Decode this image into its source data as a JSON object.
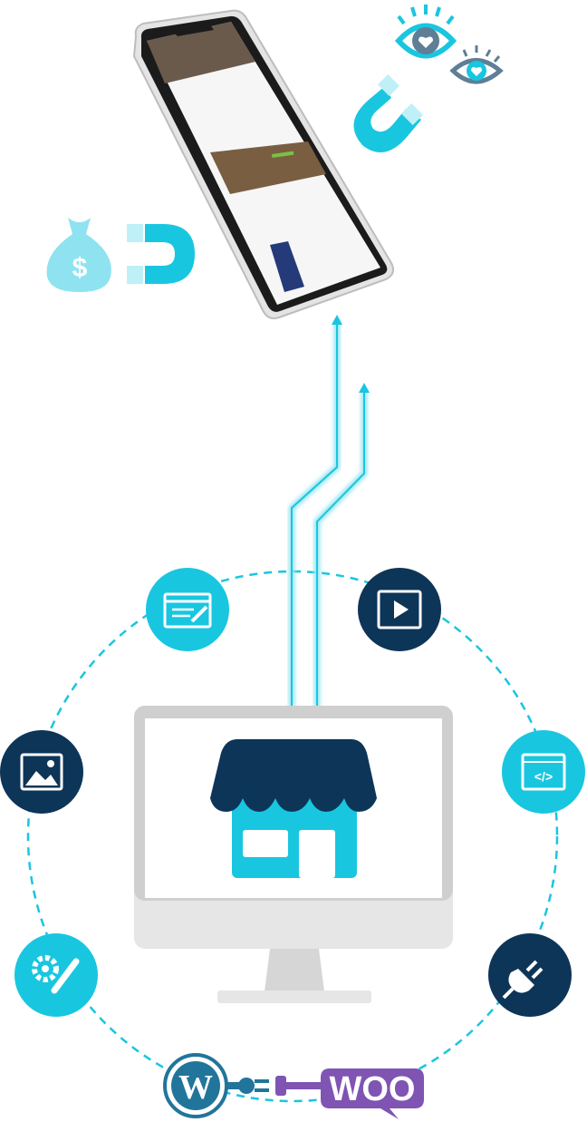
{
  "colors": {
    "cyan": "#19c6e0",
    "dark": "#0d3558",
    "light_cyan": "#9be6f2",
    "wordpress": "#21759b",
    "woo": "#7f54b3",
    "monitor": "#d9d9d9"
  },
  "icons": [
    "edit-window-icon",
    "video-play-icon",
    "image-icon",
    "code-icon",
    "settings-tools-icon",
    "plug-icon",
    "wordpress-logo",
    "woocommerce-logo",
    "store-icon",
    "eye-heart-icon",
    "magnet-icon",
    "money-bag-icon"
  ],
  "logos": {
    "woo": "WOO"
  }
}
